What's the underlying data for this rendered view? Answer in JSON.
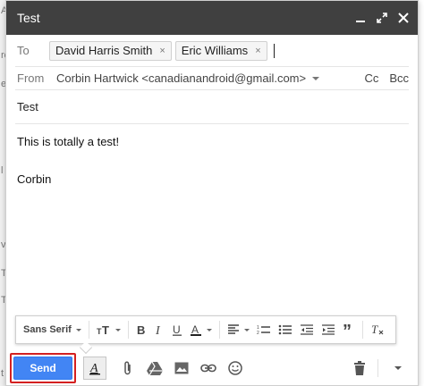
{
  "background_strip": [
    "A",
    "re",
    "e",
    "l",
    "v",
    "T",
    "T",
    "t"
  ],
  "window": {
    "title": "Test",
    "controls": [
      "minimize-icon",
      "expand-icon",
      "close-icon"
    ]
  },
  "to": {
    "label": "To",
    "recipients": [
      "David Harris Smith",
      "Eric Williams"
    ],
    "remove_glyph": "×"
  },
  "from": {
    "label": "From",
    "value": "Corbin Hartwick <canadianandroid@gmail.com>",
    "cc_label": "Cc",
    "bcc_label": "Bcc"
  },
  "subject": {
    "value": "Test"
  },
  "body": {
    "lines": [
      "This is totally a test!",
      "Corbin"
    ]
  },
  "format_toolbar": {
    "font_family": "Sans Serif",
    "buttons": [
      "text-size-icon",
      "bold-icon",
      "italic-icon",
      "underline-icon",
      "text-color-icon",
      "align-icon",
      "numbered-list-icon",
      "bulleted-list-icon",
      "indent-less-icon",
      "indent-more-icon",
      "quote-icon",
      "remove-formatting-icon"
    ]
  },
  "actions": {
    "send_label": "Send",
    "send_color": "#4285f4",
    "highlight_color": "#d42020",
    "icons": [
      "formatting-toggle-icon",
      "attach-icon",
      "drive-icon",
      "photo-icon",
      "link-icon",
      "emoji-icon",
      "trash-icon",
      "more-options-icon"
    ]
  }
}
